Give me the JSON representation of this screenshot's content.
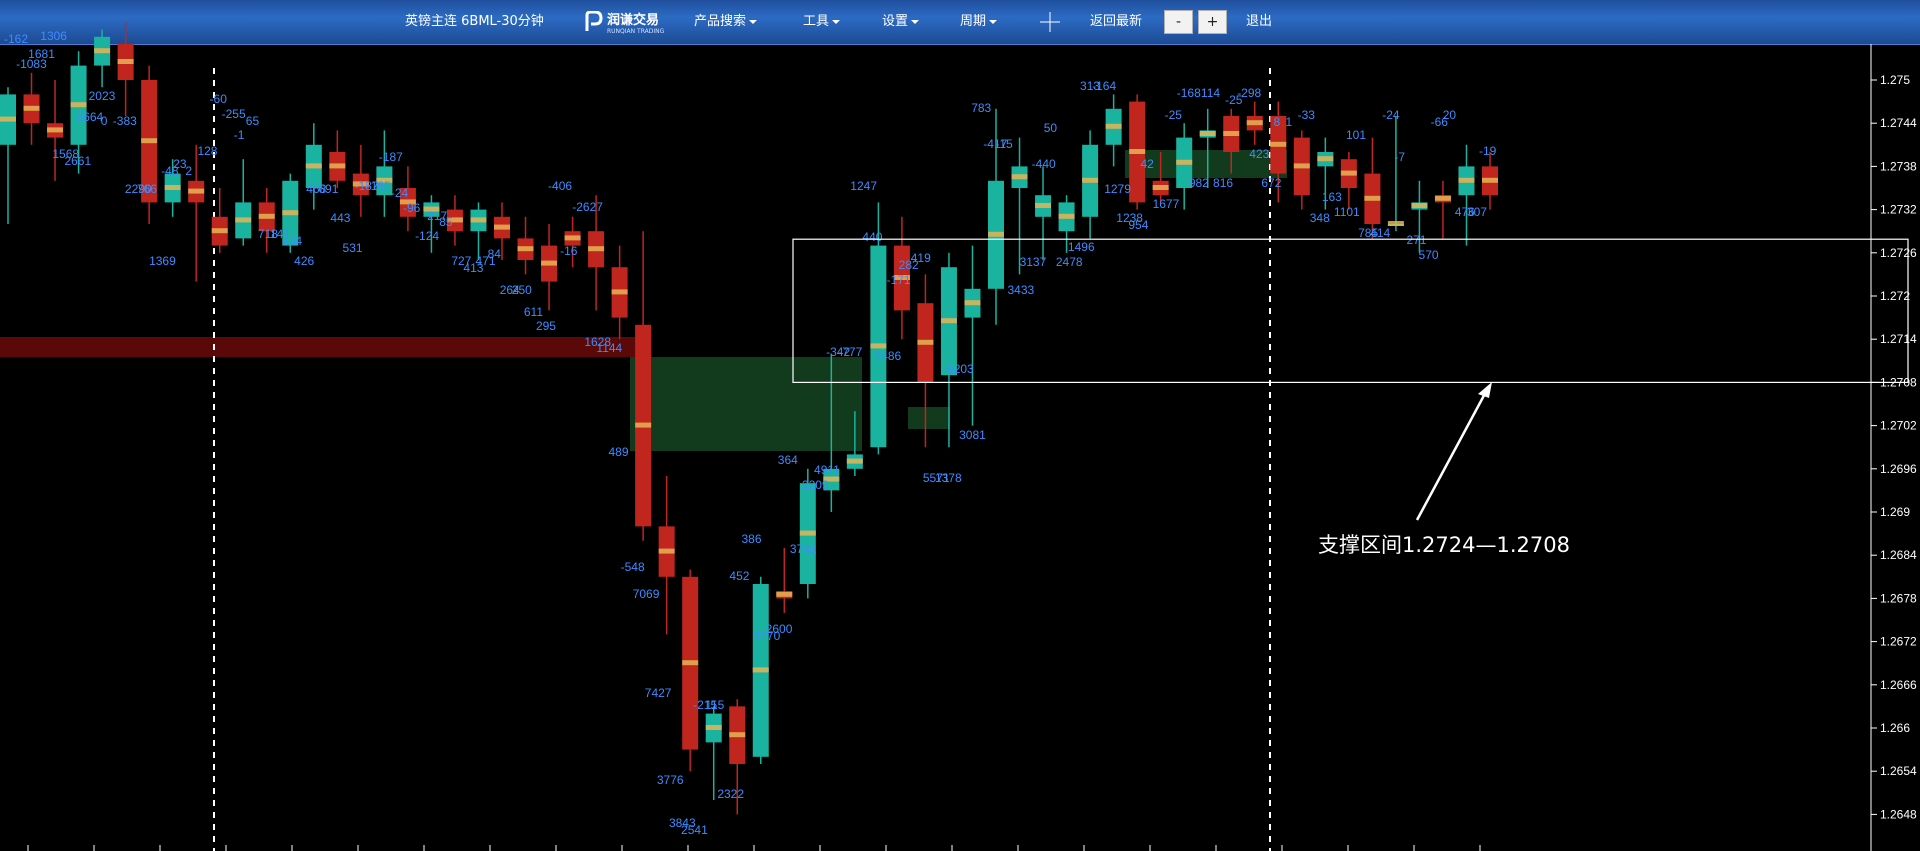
{
  "toolbar": {
    "instrument": "英镑主连 6BML-30分钟",
    "logo_text": "润谦交易",
    "logo_sub": "RUNQIAN TRADING",
    "menus": [
      "产品搜索",
      "工具",
      "设置",
      "周期"
    ],
    "back_latest": "返回最新",
    "minus": "-",
    "plus": "+",
    "exit": "退出"
  },
  "colors": {
    "bull": "#1ab3a0",
    "bear": "#c0251e",
    "label": "#3d8cff",
    "grid": "#ffffff",
    "zone": "#ffffff"
  },
  "annotation": {
    "text": "支撑区间1.2724—1.2708",
    "zone_top": 1.2724,
    "zone_bottom": 1.2708
  },
  "chart_data": {
    "type": "candlestick",
    "yaxis_ticks": [
      "1.275",
      "1.2744",
      "1.2738",
      "1.2732",
      "1.2726",
      "1.272",
      "1.2714",
      "1.2708",
      "1.2702",
      "1.2696",
      "1.269",
      "1.2684",
      "1.2678",
      "1.2672",
      "1.2666",
      "1.266",
      "1.2654",
      "1.2648"
    ],
    "candles": [
      {
        "o": 1.2741,
        "h": 1.2749,
        "l": 1.273,
        "c": 1.2748
      },
      {
        "o": 1.2748,
        "h": 1.2751,
        "l": 1.2741,
        "c": 1.2744
      },
      {
        "o": 1.2744,
        "h": 1.275,
        "l": 1.2736,
        "c": 1.2742
      },
      {
        "o": 1.2741,
        "h": 1.2754,
        "l": 1.2737,
        "c": 1.2752
      },
      {
        "o": 1.2752,
        "h": 1.2757,
        "l": 1.2749,
        "c": 1.2756
      },
      {
        "o": 1.2755,
        "h": 1.2758,
        "l": 1.2745,
        "c": 1.275
      },
      {
        "o": 1.275,
        "h": 1.2752,
        "l": 1.273,
        "c": 1.2733
      },
      {
        "o": 1.2733,
        "h": 1.2739,
        "l": 1.2731,
        "c": 1.2737
      },
      {
        "o": 1.2736,
        "h": 1.2741,
        "l": 1.2722,
        "c": 1.2733
      },
      {
        "o": 1.2731,
        "h": 1.2735,
        "l": 1.2726,
        "c": 1.2727
      },
      {
        "o": 1.2728,
        "h": 1.2739,
        "l": 1.2727,
        "c": 1.2733
      },
      {
        "o": 1.2733,
        "h": 1.2735,
        "l": 1.2726,
        "c": 1.2729
      },
      {
        "o": 1.2727,
        "h": 1.2737,
        "l": 1.2726,
        "c": 1.2736
      },
      {
        "o": 1.2735,
        "h": 1.2744,
        "l": 1.2732,
        "c": 1.2741
      },
      {
        "o": 1.274,
        "h": 1.2743,
        "l": 1.2735,
        "c": 1.2736
      },
      {
        "o": 1.2737,
        "h": 1.2741,
        "l": 1.2731,
        "c": 1.2734
      },
      {
        "o": 1.2734,
        "h": 1.2743,
        "l": 1.2731,
        "c": 1.2738
      },
      {
        "o": 1.2735,
        "h": 1.2738,
        "l": 1.2729,
        "c": 1.2731
      },
      {
        "o": 1.2731,
        "h": 1.2734,
        "l": 1.2726,
        "c": 1.2733
      },
      {
        "o": 1.2732,
        "h": 1.2734,
        "l": 1.2727,
        "c": 1.2729
      },
      {
        "o": 1.2729,
        "h": 1.2733,
        "l": 1.2725,
        "c": 1.2732
      },
      {
        "o": 1.2731,
        "h": 1.2733,
        "l": 1.2725,
        "c": 1.2728
      },
      {
        "o": 1.2728,
        "h": 1.2731,
        "l": 1.2723,
        "c": 1.2725
      },
      {
        "o": 1.2727,
        "h": 1.273,
        "l": 1.2718,
        "c": 1.2722
      },
      {
        "o": 1.2729,
        "h": 1.2731,
        "l": 1.2724,
        "c": 1.2727
      },
      {
        "o": 1.2729,
        "h": 1.2734,
        "l": 1.2718,
        "c": 1.2724
      },
      {
        "o": 1.2724,
        "h": 1.2727,
        "l": 1.2714,
        "c": 1.2717
      },
      {
        "o": 1.2716,
        "h": 1.2729,
        "l": 1.2686,
        "c": 1.2688
      },
      {
        "o": 1.2688,
        "h": 1.2695,
        "l": 1.2673,
        "c": 1.2681
      },
      {
        "o": 1.2681,
        "h": 1.2682,
        "l": 1.2654,
        "c": 1.2657
      },
      {
        "o": 1.2658,
        "h": 1.2663,
        "l": 1.265,
        "c": 1.2662
      },
      {
        "o": 1.2663,
        "h": 1.2664,
        "l": 1.2648,
        "c": 1.2655
      },
      {
        "o": 1.2656,
        "h": 1.2681,
        "l": 1.2655,
        "c": 1.268
      },
      {
        "o": 1.2679,
        "h": 1.2685,
        "l": 1.2676,
        "c": 1.2678
      },
      {
        "o": 1.268,
        "h": 1.2696,
        "l": 1.2678,
        "c": 1.2694
      },
      {
        "o": 1.2693,
        "h": 1.2712,
        "l": 1.269,
        "c": 1.2696
      },
      {
        "o": 1.2696,
        "h": 1.2704,
        "l": 1.2695,
        "c": 1.2698
      },
      {
        "o": 1.2699,
        "h": 1.2733,
        "l": 1.2698,
        "c": 1.2727
      },
      {
        "o": 1.2727,
        "h": 1.2731,
        "l": 1.2714,
        "c": 1.2718
      },
      {
        "o": 1.2719,
        "h": 1.2723,
        "l": 1.2699,
        "c": 1.2708
      },
      {
        "o": 1.2709,
        "h": 1.2726,
        "l": 1.2699,
        "c": 1.2724
      },
      {
        "o": 1.2717,
        "h": 1.2727,
        "l": 1.2702,
        "c": 1.2721
      },
      {
        "o": 1.2721,
        "h": 1.2746,
        "l": 1.2716,
        "c": 1.2736
      },
      {
        "o": 1.2735,
        "h": 1.2742,
        "l": 1.2723,
        "c": 1.2738
      },
      {
        "o": 1.2731,
        "h": 1.2738,
        "l": 1.2725,
        "c": 1.2734
      },
      {
        "o": 1.2729,
        "h": 1.2734,
        "l": 1.2726,
        "c": 1.2733
      },
      {
        "o": 1.2731,
        "h": 1.2743,
        "l": 1.2728,
        "c": 1.2741
      },
      {
        "o": 1.2741,
        "h": 1.2748,
        "l": 1.2738,
        "c": 1.2746
      },
      {
        "o": 1.2747,
        "h": 1.2748,
        "l": 1.2732,
        "c": 1.2733
      },
      {
        "o": 1.2736,
        "h": 1.274,
        "l": 1.2733,
        "c": 1.2734
      },
      {
        "o": 1.2735,
        "h": 1.2744,
        "l": 1.2732,
        "c": 1.2742
      },
      {
        "o": 1.2742,
        "h": 1.2746,
        "l": 1.2735,
        "c": 1.2743
      },
      {
        "o": 1.2745,
        "h": 1.2746,
        "l": 1.2737,
        "c": 1.274
      },
      {
        "o": 1.2745,
        "h": 1.2747,
        "l": 1.2741,
        "c": 1.2743
      },
      {
        "o": 1.2745,
        "h": 1.2747,
        "l": 1.2733,
        "c": 1.2737
      },
      {
        "o": 1.2742,
        "h": 1.2743,
        "l": 1.2732,
        "c": 1.2734
      },
      {
        "o": 1.2738,
        "h": 1.2742,
        "l": 1.2732,
        "c": 1.274
      },
      {
        "o": 1.2739,
        "h": 1.274,
        "l": 1.2732,
        "c": 1.2735
      },
      {
        "o": 1.2737,
        "h": 1.2742,
        "l": 1.2728,
        "c": 1.273
      },
      {
        "o": 1.273,
        "h": 1.2745,
        "l": 1.2729,
        "c": 1.273
      },
      {
        "o": 1.2732,
        "h": 1.2736,
        "l": 1.2726,
        "c": 1.2733
      },
      {
        "o": 1.2734,
        "h": 1.2736,
        "l": 1.2728,
        "c": 1.2733
      },
      {
        "o": 1.2734,
        "h": 1.2741,
        "l": 1.2727,
        "c": 1.2738
      },
      {
        "o": 1.2738,
        "h": 1.274,
        "l": 1.2732,
        "c": 1.2734
      }
    ],
    "labels": [
      [
        "-162",
        0,
        43
      ],
      [
        "-1083",
        0,
        68
      ],
      [
        "1681",
        0,
        58
      ],
      [
        "1306",
        0,
        40
      ],
      [
        "1568",
        0,
        158
      ],
      [
        "2661",
        0,
        165
      ],
      [
        "2664",
        0,
        121
      ],
      [
        "2023",
        0,
        100
      ],
      [
        "0",
        0,
        125
      ],
      [
        "-383",
        0,
        125
      ],
      [
        "2290",
        0,
        193
      ],
      [
        "766",
        0,
        193
      ],
      [
        "1369",
        0,
        265
      ],
      [
        "-48",
        0,
        175
      ],
      [
        "23",
        0,
        168
      ],
      [
        "2",
        0,
        175
      ],
      [
        "128",
        0,
        155
      ],
      [
        "-60",
        0,
        103
      ],
      [
        "-255",
        0,
        118
      ],
      [
        "-1",
        0,
        139
      ],
      [
        "65",
        0,
        125
      ],
      [
        "718",
        0,
        238
      ],
      [
        "141",
        0,
        238
      ],
      [
        "534",
        0,
        245
      ],
      [
        "426",
        0,
        265
      ],
      [
        "468",
        0,
        193
      ],
      [
        "691",
        0,
        193
      ],
      [
        "443",
        0,
        222
      ],
      [
        "531",
        0,
        252
      ],
      [
        "-187",
        0,
        190
      ],
      [
        "-165",
        0,
        190
      ],
      [
        "-187",
        0,
        161
      ],
      [
        "-24",
        0,
        197
      ],
      [
        "-96",
        0,
        212
      ],
      [
        "-124",
        0,
        240
      ],
      [
        "217",
        0,
        220
      ],
      [
        "85",
        0,
        226
      ],
      [
        "727",
        0,
        265
      ],
      [
        "413",
        0,
        272
      ],
      [
        "471",
        0,
        265
      ],
      [
        "84",
        0,
        258
      ],
      [
        "264",
        0,
        294
      ],
      [
        "250",
        0,
        294
      ],
      [
        "611",
        0,
        316
      ],
      [
        "295",
        0,
        330
      ],
      [
        "-406",
        0,
        190
      ],
      [
        "-16",
        0,
        255
      ],
      [
        "-2627",
        0,
        211
      ],
      [
        "1628",
        0,
        346
      ],
      [
        "1144",
        0,
        352
      ],
      [
        "489",
        0,
        456
      ],
      [
        "-548",
        0,
        571
      ],
      [
        "7069",
        0,
        598
      ],
      [
        "7427",
        0,
        697
      ],
      [
        "3776",
        0,
        784
      ],
      [
        "3843",
        0,
        827
      ],
      [
        "2541",
        0,
        834
      ],
      [
        "-215",
        0,
        709
      ],
      [
        "115",
        0,
        709
      ],
      [
        "2322",
        0,
        798
      ],
      [
        "452",
        0,
        580
      ],
      [
        "386",
        0,
        543
      ],
      [
        "3270",
        0,
        640
      ],
      [
        "2600",
        0,
        633
      ],
      [
        "364",
        0,
        464
      ],
      [
        "3742",
        0,
        553
      ],
      [
        "2209",
        0,
        489
      ],
      [
        "4911",
        0,
        474
      ],
      [
        "-342",
        0,
        356
      ],
      [
        "-777",
        0,
        356
      ],
      [
        "1247",
        0,
        190
      ],
      [
        "440",
        0,
        241
      ],
      [
        "3486",
        0,
        360
      ],
      [
        "-171",
        0,
        284
      ],
      [
        "282",
        0,
        269
      ],
      [
        "419",
        0,
        262
      ],
      [
        "5571",
        0,
        482
      ],
      [
        "1378",
        0,
        482
      ],
      [
        "6203",
        0,
        373
      ],
      [
        "3081",
        0,
        439
      ],
      [
        "783",
        0,
        112
      ],
      [
        "-417",
        0,
        148
      ],
      [
        "-15",
        0,
        148
      ],
      [
        "3433",
        0,
        294
      ],
      [
        "3137",
        0,
        266
      ],
      [
        "-440",
        0,
        168
      ],
      [
        "50",
        0,
        132
      ],
      [
        "2478",
        0,
        266
      ],
      [
        "1496",
        0,
        251
      ],
      [
        "313",
        0,
        90
      ],
      [
        "-164",
        0,
        90
      ],
      [
        "1279",
        0,
        193
      ],
      [
        "1238",
        0,
        222
      ],
      [
        "954",
        0,
        229
      ],
      [
        "42",
        0,
        168
      ],
      [
        "1677",
        0,
        208
      ],
      [
        "-25",
        0,
        119
      ],
      [
        "-168",
        0,
        97
      ],
      [
        "982",
        0,
        187
      ],
      [
        "114",
        0,
        97
      ],
      [
        "816",
        0,
        187
      ],
      [
        "-25",
        0,
        104
      ],
      [
        "-298",
        0,
        97
      ],
      [
        "423",
        0,
        158
      ],
      [
        "672",
        0,
        187
      ],
      [
        "8",
        0,
        126
      ],
      [
        "1",
        0,
        126
      ],
      [
        "-33",
        0,
        119
      ],
      [
        "348",
        0,
        222
      ],
      [
        "163",
        0,
        201
      ],
      [
        "1101",
        0,
        216
      ],
      [
        "101",
        0,
        139
      ],
      [
        "785",
        0,
        237
      ],
      [
        "414",
        0,
        237
      ],
      [
        "-24",
        0,
        119
      ],
      [
        "-7",
        0,
        161
      ],
      [
        "271",
        0,
        244
      ],
      [
        "570",
        0,
        259
      ],
      [
        "-66",
        0,
        126
      ],
      [
        "20",
        0,
        119
      ],
      [
        "476",
        0,
        216
      ],
      [
        "307",
        0,
        216
      ],
      [
        "-19",
        0,
        155
      ]
    ]
  }
}
